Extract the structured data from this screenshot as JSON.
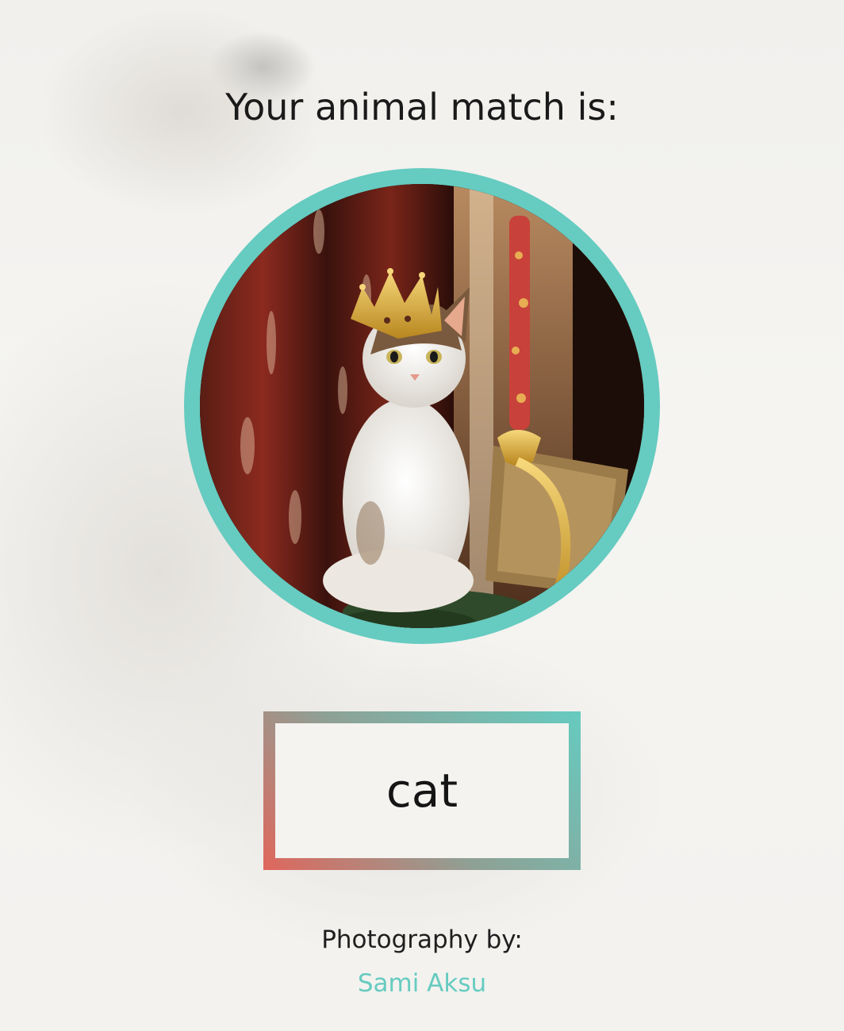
{
  "heading": "Your animal match is:",
  "photo": {
    "alt": "cat wearing a golden crown"
  },
  "match": {
    "animal": "cat"
  },
  "credit": {
    "label": "Photography by:",
    "photographer": "Sami Aksu"
  },
  "colors": {
    "accent": "#66cbc0",
    "gradient_start": "#e0665c",
    "gradient_end": "#66cbc0",
    "text": "#1a1a1a"
  }
}
